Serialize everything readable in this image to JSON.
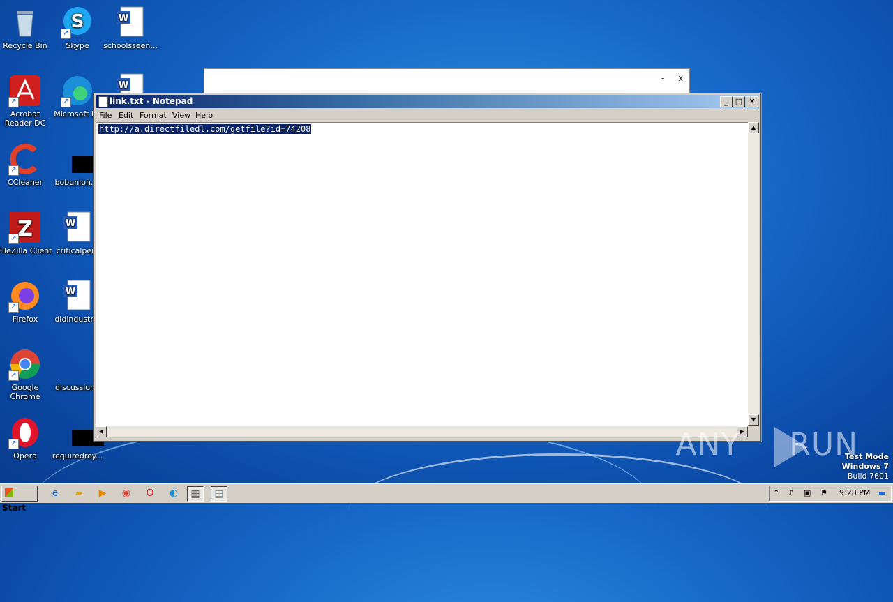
{
  "desktop": {
    "icons": [
      {
        "id": "recycle-bin",
        "label": "Recycle Bin"
      },
      {
        "id": "skype",
        "label": "Skype"
      },
      {
        "id": "schoolsseen",
        "label": "schoolsseen..."
      },
      {
        "id": "acrobat",
        "label": "Acrobat Reader DC"
      },
      {
        "id": "edge",
        "label": "Microsoft Ed"
      },
      {
        "id": "ccleaner",
        "label": "CCleaner"
      },
      {
        "id": "bobunion",
        "label": "bobunion.jp"
      },
      {
        "id": "filezilla",
        "label": "FileZilla Client"
      },
      {
        "id": "criticalpers",
        "label": "criticalpers"
      },
      {
        "id": "firefox",
        "label": "Firefox"
      },
      {
        "id": "didindustria",
        "label": "didindustria"
      },
      {
        "id": "chrome",
        "label": "Google Chrome"
      },
      {
        "id": "discussionh",
        "label": "discussionh"
      },
      {
        "id": "opera",
        "label": "Opera"
      },
      {
        "id": "requiredroy",
        "label": "requiredroy..."
      }
    ]
  },
  "bg_window": {
    "minimize": "-",
    "close": "x"
  },
  "notepad": {
    "title": "link.txt - Notepad",
    "menu": [
      "File",
      "Edit",
      "Format",
      "View",
      "Help"
    ],
    "content": "http://a.directfiledl.com/getfile?id=74208",
    "buttons": {
      "minimize": "_",
      "maximize": "□",
      "close": "✕"
    }
  },
  "watermark": {
    "left": "ANY",
    "right": "RUN"
  },
  "testmode": {
    "line1": "Test Mode",
    "line2": "Windows 7",
    "line3": "Build 7601"
  },
  "taskbar": {
    "start": "Start",
    "time": "9:28 PM"
  }
}
